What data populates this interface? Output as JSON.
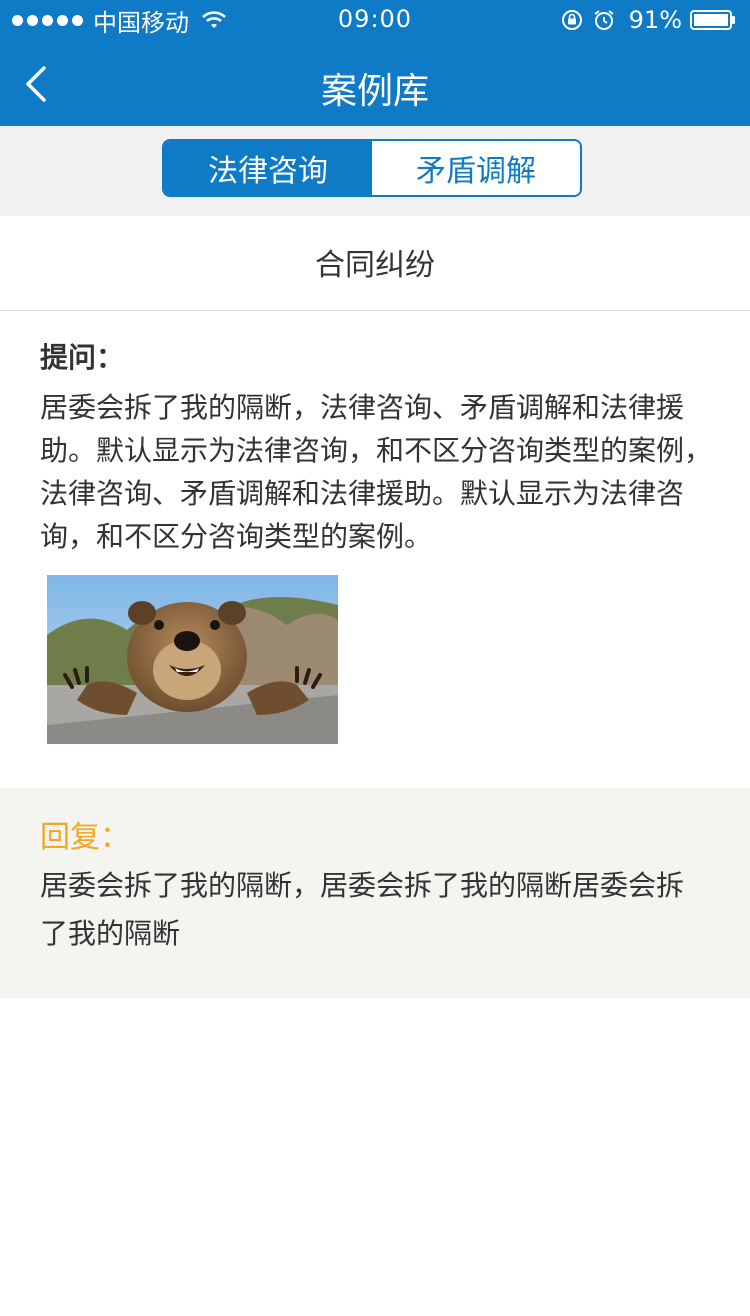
{
  "status_bar": {
    "carrier": "中国移动",
    "time": "09:00",
    "battery_percent": "91%",
    "signal_icon": "signal-dots-icon",
    "wifi_icon": "wifi-icon",
    "rotation_lock_icon": "rotation-lock-icon",
    "alarm_icon": "alarm-clock-icon",
    "battery_icon": "battery-icon"
  },
  "nav": {
    "title": "案例库",
    "back_icon": "chevron-left-icon"
  },
  "tabs": [
    {
      "label": "法律咨询",
      "active": true
    },
    {
      "label": "矛盾调解",
      "active": false
    }
  ],
  "case": {
    "title": "合同纠纷",
    "question_label": "提问：",
    "question_text": "居委会拆了我的隔断，法律咨询、矛盾调解和法律援助。默认显示为法律咨询，和不区分咨询类型的案例，法律咨询、矛盾调解和法律援助。默认显示为法律咨询，和不区分咨询类型的案例。",
    "reply_label": "回复：",
    "reply_text": "居委会拆了我的隔断，居委会拆了我的隔断居委会拆了我的隔断"
  },
  "colors": {
    "primary": "#0f7ac6",
    "reply_label": "#f5a623",
    "reply_bg": "#f4f4f1"
  }
}
